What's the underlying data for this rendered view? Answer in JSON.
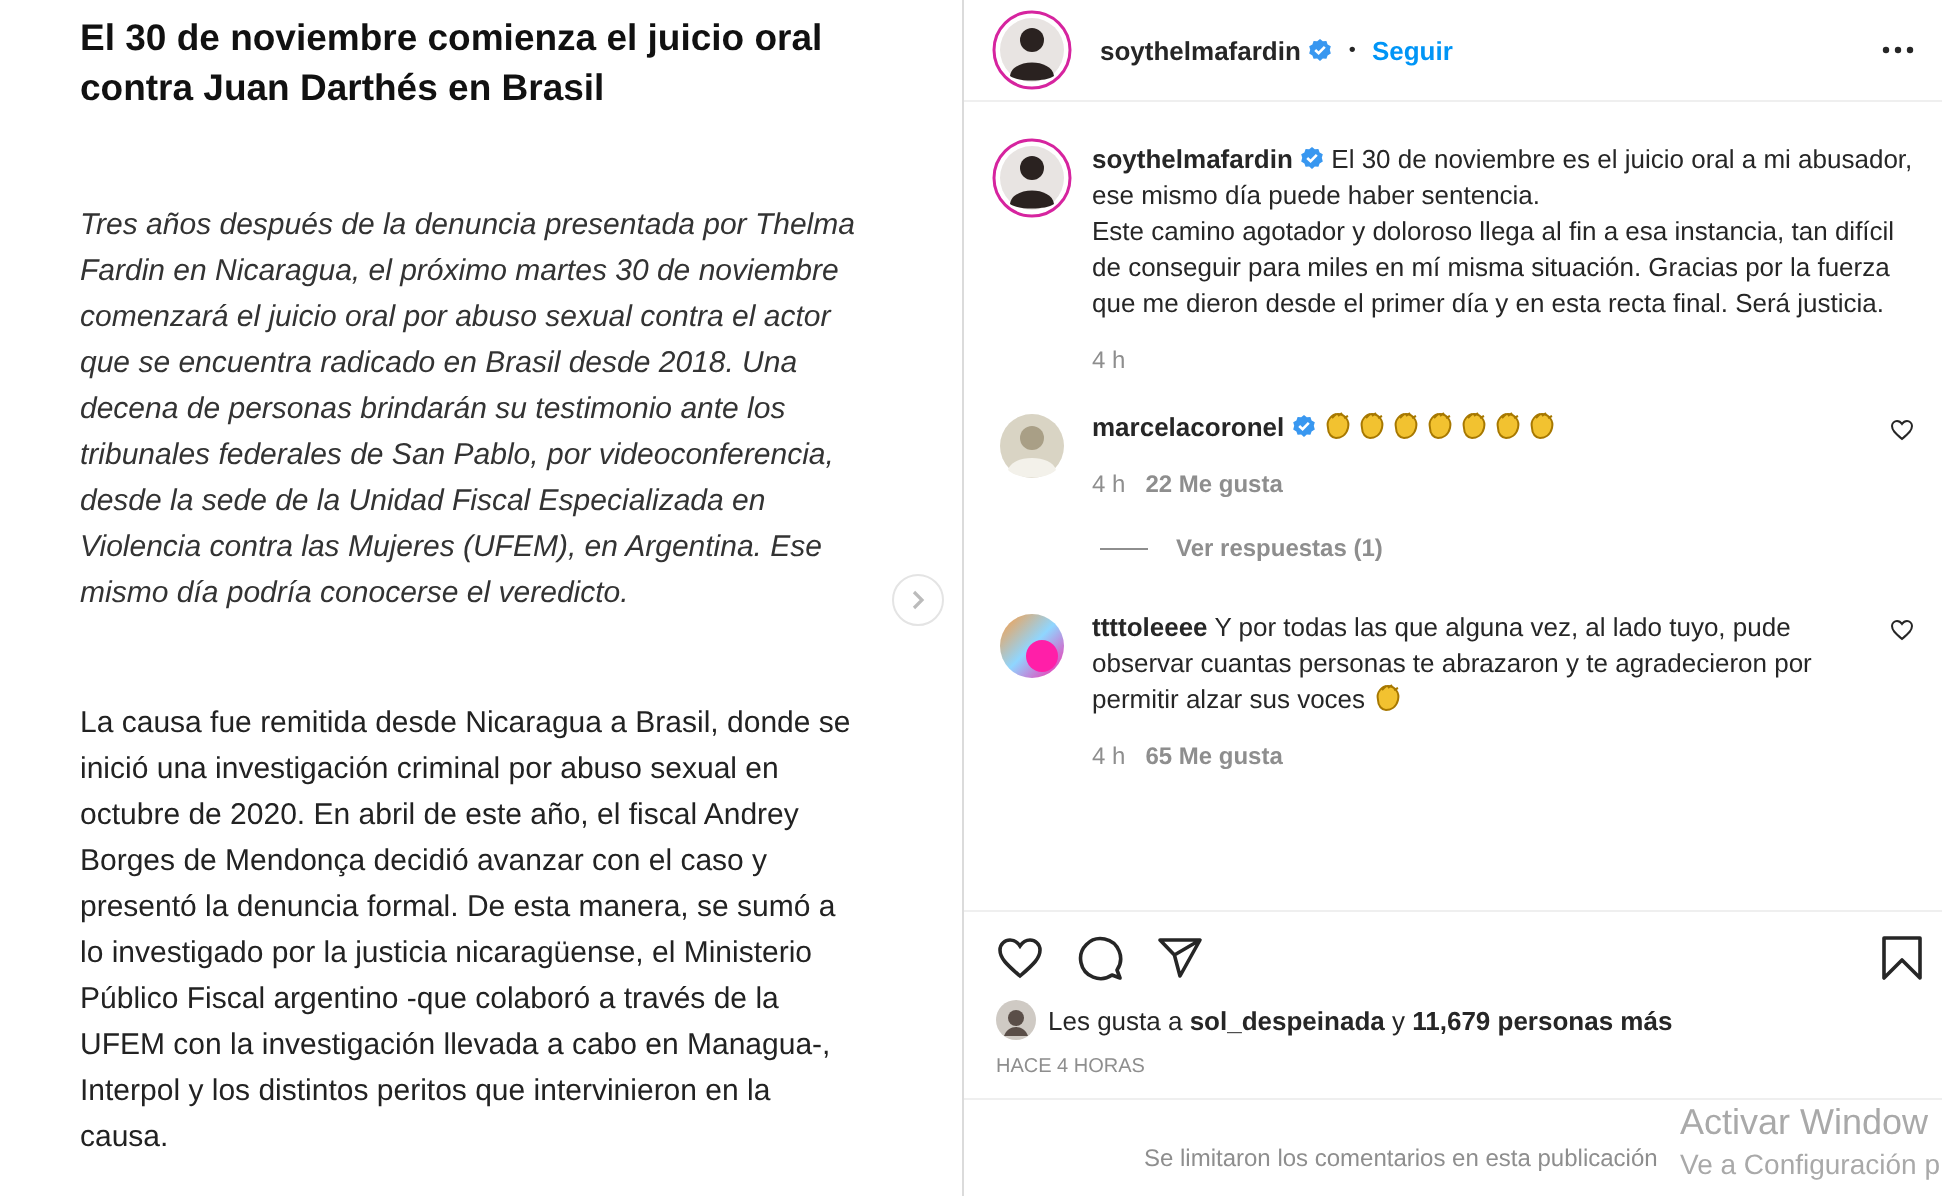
{
  "post_image": {
    "headline": "El 30 de noviembre comienza el juicio oral contra Juan Darthés en Brasil",
    "paragraphs": [
      {
        "kind": "italic",
        "text": "Tres años después de la denuncia presentada por Thelma Fardin en Nicaragua, el próximo martes 30 de noviembre comenzará el juicio oral por abuso sexual contra el actor que se encuentra radicado en Brasil desde 2018. Una decena de personas brindarán su testimonio ante los tribunales federales de San Pablo, por videoconferencia, desde la sede de la Unidad Fiscal Especializada en Violencia contra las Mujeres (UFEM), en Argentina. Ese mismo día podría conocerse el veredicto."
      },
      {
        "kind": "plain",
        "text": "La causa fue remitida desde Nicaragua a Brasil, donde se inició una investigación criminal por abuso sexual en octubre de 2020. En abril de este año, el fiscal Andrey Borges de Mendonça decidió avanzar con el caso y presentó la denuncia formal. De esta manera, se sumó a lo investigado por la justicia nicaragüense, el Ministerio Público Fiscal argentino -que colaboró a través de la UFEM con la investigación llevada a cabo en Managua-, Interpol y los distintos peritos que intervinieron en la causa."
      }
    ]
  },
  "header": {
    "username": "soythelmafardin",
    "verified": true,
    "separator": "•",
    "follow": "Seguir"
  },
  "caption": {
    "username": "soythelmafardin",
    "verified": true,
    "text": "El 30 de noviembre es el juicio oral a mi abusador, ese mismo día puede haber sentencia.\nEste camino agotador y doloroso llega al fin a esa instancia, tan difícil de conseguir para miles en mí misma situación. Gracias por la fuerza que me dieron desde el primer día y en esta recta final. Será justicia.",
    "time": "4 h"
  },
  "comments": [
    {
      "username": "marcelacoronel",
      "verified": true,
      "time": "4 h",
      "likes": "22 Me gusta",
      "replies": "Ver respuestas (1)"
    },
    {
      "username": "ttttoleeee",
      "verified": false,
      "text": "Y por todas las que alguna vez, al lado tuyo, pude observar cuantas personas te abrazaron y te agradecieron por permitir alzar sus voces",
      "time": "4 h",
      "likes": "65 Me gusta"
    }
  ],
  "likes_line": {
    "prefix": "Les gusta a",
    "user": "sol_despeinada",
    "middle": "y",
    "count": "11,679 personas más"
  },
  "posted": "HACE 4 HORAS",
  "comments_notice": "Se limitaron los comentarios en esta publicación",
  "os_notice": {
    "title": "Activar Window",
    "subtitle": "Ve a Configuración p"
  }
}
